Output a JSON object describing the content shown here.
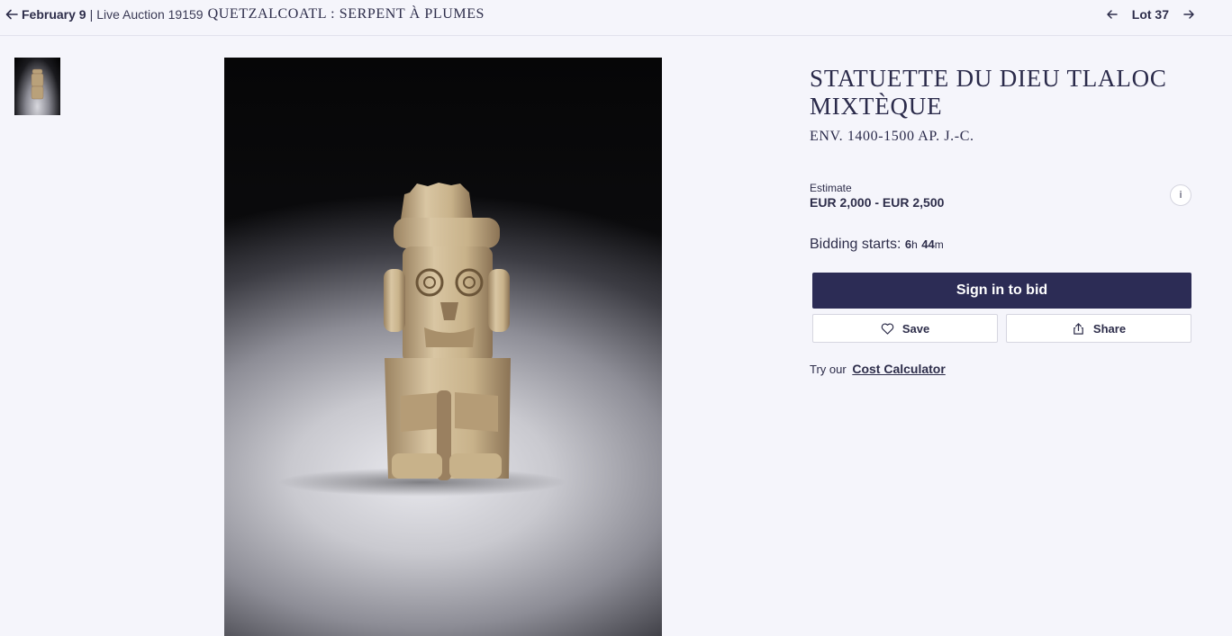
{
  "breadcrumb": {
    "date": "February 9",
    "separator": "|",
    "auction_label": "Live Auction 19159",
    "auction_title": "QUETZALCOATL : SERPENT À PLUMES",
    "back_icon": "arrow-left-icon"
  },
  "lot_nav": {
    "lot_label": "Lot 37",
    "prev_icon": "arrow-left-icon",
    "next_icon": "arrow-right-icon"
  },
  "lot": {
    "title": "STATUETTE DU DIEU TLALOC MIXTÈQUE",
    "subtitle": "ENV. 1400-1500 AP. J.-C."
  },
  "estimate": {
    "label": "Estimate",
    "value": "EUR 2,000 - EUR 2,500",
    "info_label": "i"
  },
  "bidding": {
    "label": "Bidding starts:",
    "hours": "6",
    "hours_unit": "h",
    "minutes": "44",
    "minutes_unit": "m"
  },
  "buttons": {
    "sign_in": "Sign in to bid",
    "save": "Save",
    "share": "Share",
    "save_icon": "heart-icon",
    "share_icon": "share-icon"
  },
  "calculator": {
    "prefix": "Try our",
    "link": "Cost Calculator"
  },
  "colors": {
    "primary_button": "#2c2c55",
    "background": "#f5f5fb",
    "text": "#2d2d4a"
  }
}
